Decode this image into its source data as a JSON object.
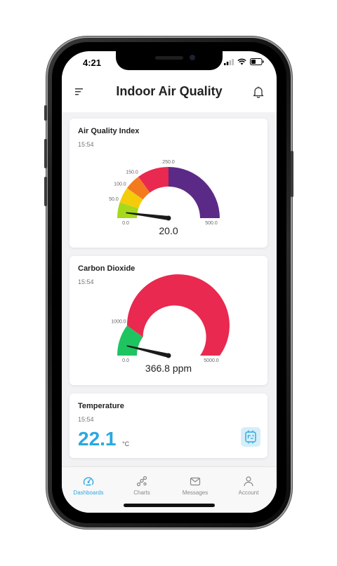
{
  "status_bar": {
    "time": "4:21"
  },
  "header": {
    "title": "Indoor Air Quality"
  },
  "cards": {
    "aqi": {
      "title": "Air Quality Index",
      "time": "15:54",
      "value_label": "20.0",
      "gauge": {
        "min": 0,
        "max": 500,
        "value": 20,
        "bands": [
          {
            "from": 0,
            "to": 50,
            "color": "#a6d81c"
          },
          {
            "from": 50,
            "to": 100,
            "color": "#f5cc0a"
          },
          {
            "from": 100,
            "to": 150,
            "color": "#f47a1f"
          },
          {
            "from": 150,
            "to": 250,
            "color": "#e9294f"
          },
          {
            "from": 250,
            "to": 500,
            "color": "#5b2a86"
          }
        ],
        "tick_labels": [
          "0.0",
          "50.0",
          "100.0",
          "150.0",
          "250.0",
          "500.0"
        ]
      }
    },
    "co2": {
      "title": "Carbon Dioxide",
      "time": "15:54",
      "value_label": "366.8 ppm",
      "gauge": {
        "min": 0,
        "max": 5000,
        "value": 366.8,
        "bands": [
          {
            "from": 0,
            "to": 1000,
            "color": "#1ec45f"
          },
          {
            "from": 1000,
            "to": 5000,
            "color": "#e9294f"
          }
        ],
        "tick_labels": [
          "0.0",
          "1000.0",
          "5000.0"
        ]
      }
    },
    "temperature": {
      "title": "Temperature",
      "time": "15:54",
      "value": "22.1",
      "unit": "°C"
    }
  },
  "nav": {
    "items": [
      {
        "label": "Dashboards",
        "icon": "dashboard-icon",
        "active": true
      },
      {
        "label": "Charts",
        "icon": "charts-icon",
        "active": false
      },
      {
        "label": "Messages",
        "icon": "messages-icon",
        "active": false
      },
      {
        "label": "Account",
        "icon": "account-icon",
        "active": false
      }
    ]
  },
  "colors": {
    "accent": "#2aa8e0",
    "needle": "#1a1a1a"
  }
}
